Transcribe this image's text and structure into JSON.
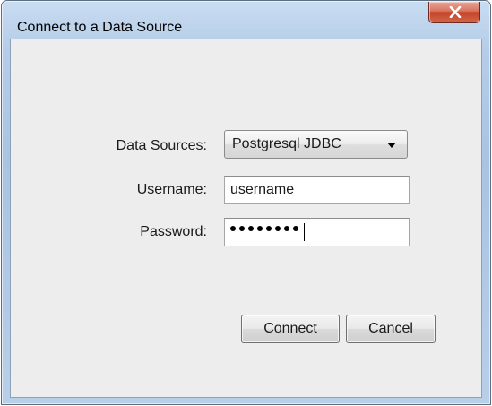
{
  "window": {
    "title": "Connect to a Data Source",
    "close_glyph": "X"
  },
  "form": {
    "data_sources_label": "Data Sources:",
    "data_sources_value": "Postgresql JDBC",
    "username_label": "Username:",
    "username_value": "username",
    "password_label": "Password:",
    "password_length": 8
  },
  "buttons": {
    "connect_label": "Connect",
    "cancel_label": "Cancel"
  },
  "icons": {
    "close": "close-icon",
    "dropdown": "chevron-down-icon"
  },
  "colors": {
    "titlebar": "#b5cde8",
    "close_button": "#c44429",
    "client_background": "#ededed"
  }
}
